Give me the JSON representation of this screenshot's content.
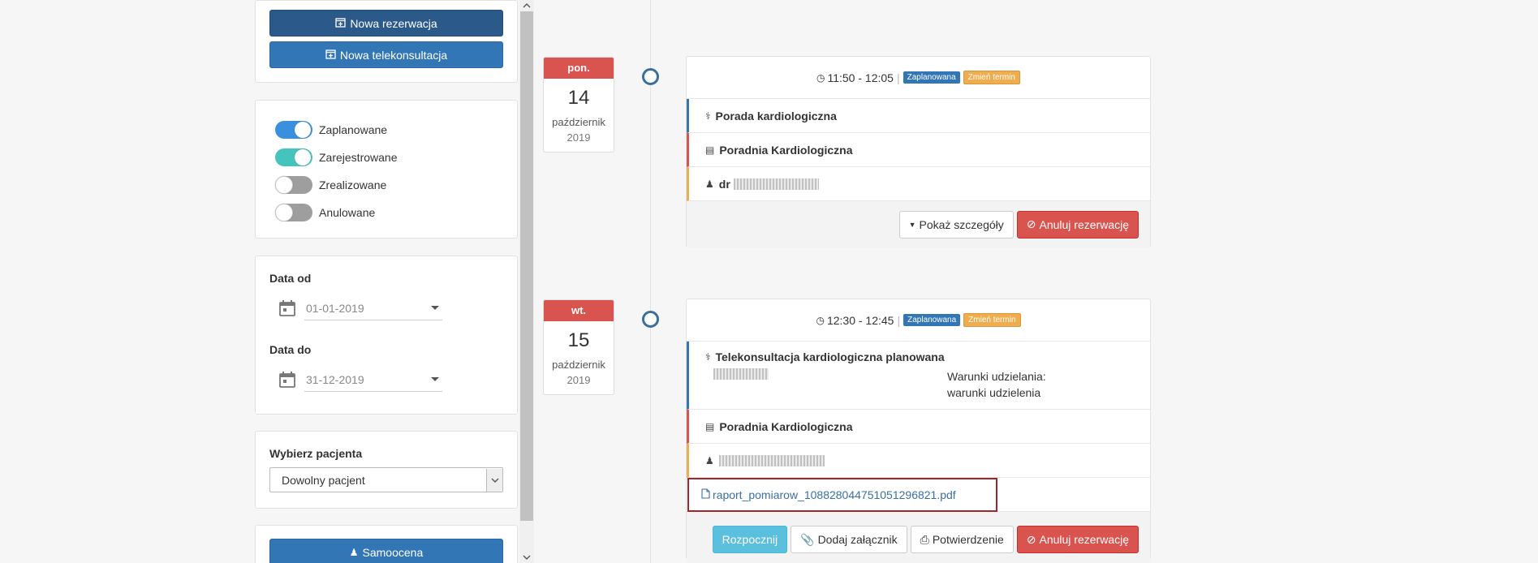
{
  "sidebar": {
    "new_reservation": "Nowa rezerwacja",
    "new_teleconsult": "Nowa telekonsultacja",
    "filters": [
      {
        "label": "Zaplanowane",
        "state": "on",
        "color": "#3a8fde"
      },
      {
        "label": "Zarejestrowane",
        "state": "on",
        "color": "#45c4bd"
      },
      {
        "label": "Zrealizowane",
        "state": "off"
      },
      {
        "label": "Anulowane",
        "state": "off"
      }
    ],
    "date_from_label": "Data od",
    "date_from_value": "01-01-2019",
    "date_to_label": "Data do",
    "date_to_value": "31-12-2019",
    "patient_label": "Wybierz pacjenta",
    "patient_value": "Dowolny pacjent",
    "self_assessment": "Samoocena"
  },
  "appointments": [
    {
      "date": {
        "dow": "pon.",
        "day": "14",
        "month": "październik",
        "year": "2019"
      },
      "time": "11:50 - 12:05",
      "status": "Zaplanowana",
      "change": "Zmień termin",
      "service": "Porada kardiologiczna",
      "clinic": "Poradnia Kardiologiczna",
      "doctor_prefix": "dr",
      "buttons": {
        "details": "Pokaż szczegóły",
        "cancel": "Anuluj rezerwację"
      }
    },
    {
      "date": {
        "dow": "wt.",
        "day": "15",
        "month": "październik",
        "year": "2019"
      },
      "time": "12:30 - 12:45",
      "status": "Zaplanowana",
      "change": "Zmień termin",
      "service": "Telekonsultacja kardiologiczna planowana",
      "conditions_label": "Warunki udzielania:",
      "conditions_value": "warunki udzielenia",
      "clinic": "Poradnia Kardiologiczna",
      "attachment": "raport_pomiarow_108828044751051296821.pdf",
      "buttons": {
        "start": "Rozpocznij",
        "attach": "Dodaj załącznik",
        "confirm": "Potwierdzenie",
        "cancel": "Anuluj rezerwację"
      }
    }
  ]
}
